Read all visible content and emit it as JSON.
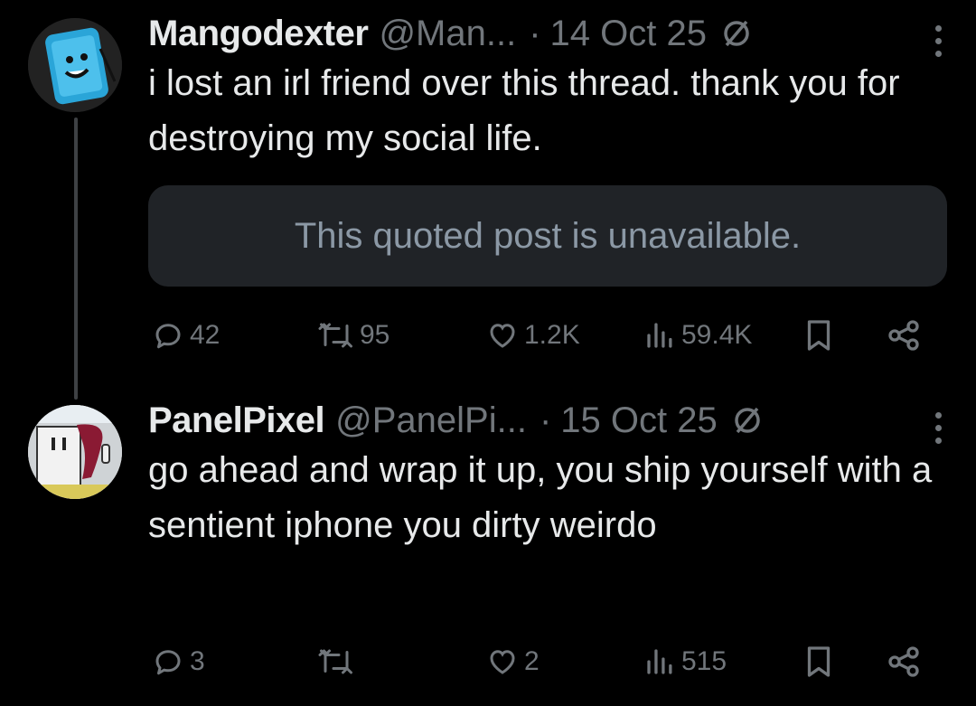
{
  "tweets": [
    {
      "name": "Mangodexter",
      "handle": "@Man...",
      "date": "14 Oct 25",
      "text": "i lost an irl friend over this thread. thank you for destroying my social life.",
      "quote": "This quoted post is unavailable.",
      "replies": "42",
      "reposts": "95",
      "likes": "1.2K",
      "views": "59.4K"
    },
    {
      "name": "PanelPixel",
      "handle": "@PanelPi...",
      "date": "15 Oct 25",
      "text": "go ahead and wrap it up, you ship yourself with a sentient iphone you dirty weirdo",
      "replies": "3",
      "reposts": "",
      "likes": "2",
      "views": "515"
    }
  ],
  "separator": "·",
  "colors": {
    "background": "#000000",
    "text": "#e7e9ea",
    "muted": "#71767b",
    "quote_bg": "#202327",
    "avatar1_bg": "#2aa5d8",
    "avatar2_accent": "#8a1a33"
  },
  "icons": [
    "reply-icon",
    "repost-icon",
    "like-icon",
    "views-icon",
    "bookmark-icon",
    "share-icon",
    "more-icon",
    "no-entry-badge-icon"
  ]
}
